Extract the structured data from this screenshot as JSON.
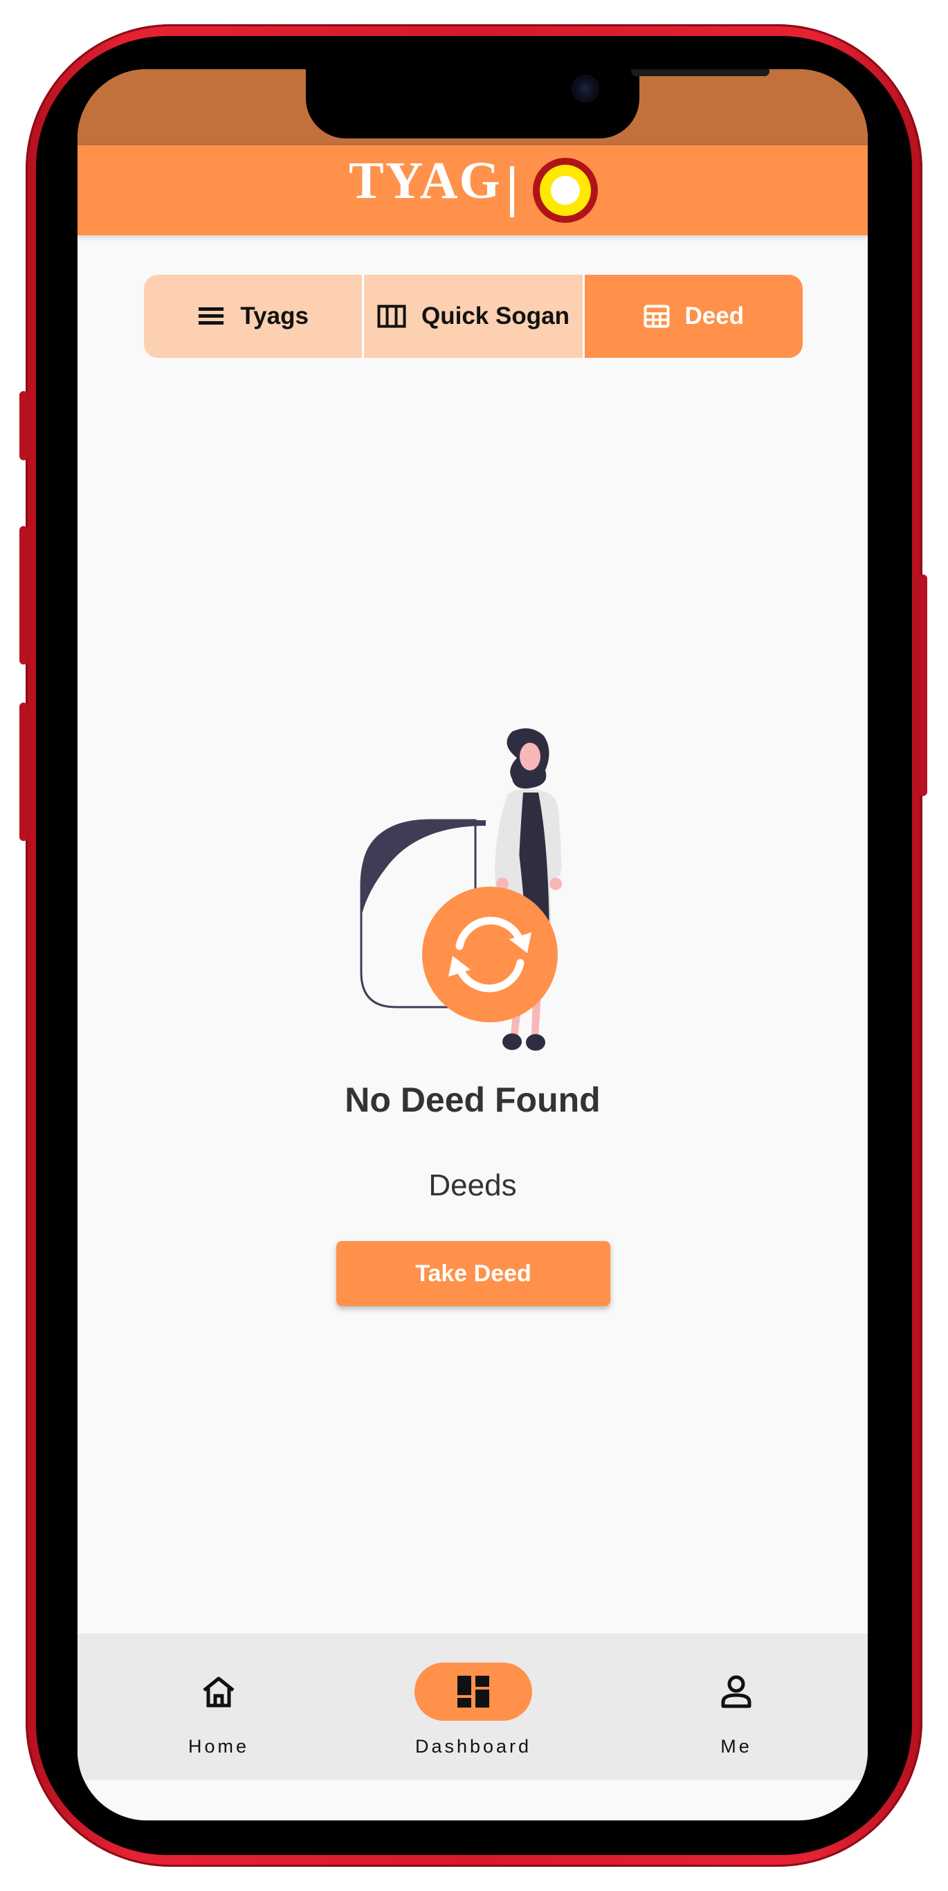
{
  "app": {
    "title": "TYAG"
  },
  "tabs": [
    {
      "label": "Tyags",
      "icon": "list-icon",
      "active": false
    },
    {
      "label": "Quick Sogan",
      "icon": "columns-icon",
      "active": false
    },
    {
      "label": "Deed",
      "icon": "grid-icon",
      "active": true
    }
  ],
  "empty_state": {
    "title": "No Deed Found",
    "subtitle": "Deeds",
    "action_label": "Take Deed",
    "illustration": "woman-with-refresh-icon"
  },
  "bottom_nav": [
    {
      "label": "Home",
      "icon": "home-icon",
      "active": false
    },
    {
      "label": "Dashboard",
      "icon": "dashboard-icon",
      "active": true
    },
    {
      "label": "Me",
      "icon": "person-icon",
      "active": false
    }
  ],
  "colors": {
    "primary": "#ff914a",
    "primary_light": "#fdd0b1",
    "status_bar": "#c2703c",
    "phone_body": "#e52233",
    "text_dark": "#333333",
    "nav_bg": "#eaeaea",
    "illustration_dark": "#3f3d56"
  }
}
